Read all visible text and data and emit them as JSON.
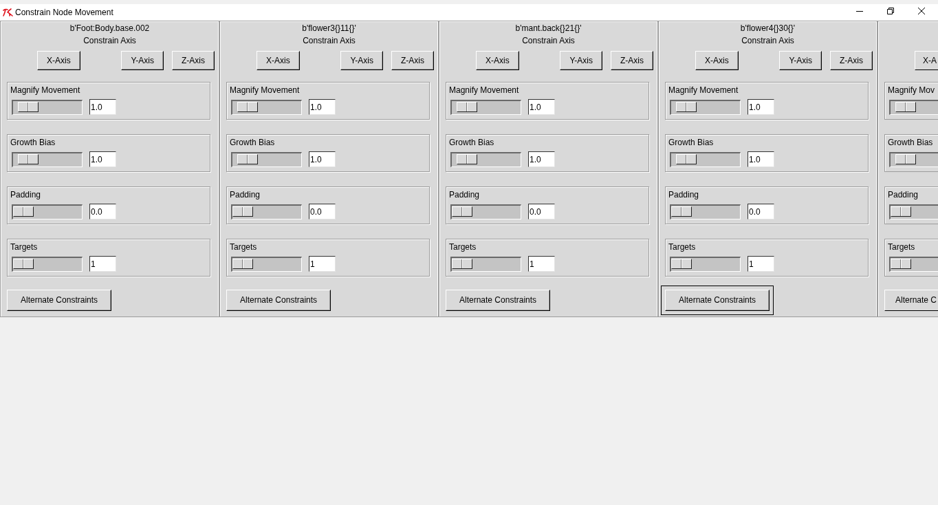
{
  "window": {
    "title": "Constrain Node Movement"
  },
  "panels": [
    {
      "node": "b'Foot:Body.base.002",
      "axis_label": "Constrain Axis",
      "axis_buttons": [
        "X-Axis",
        "Y-Axis",
        "Z-Axis"
      ],
      "settings": [
        {
          "label": "Magnify Movement",
          "level": 0.1,
          "value": "1.0"
        },
        {
          "label": "Growth Bias",
          "level": 0.1,
          "value": "1.0"
        },
        {
          "label": "Padding",
          "level": 0,
          "value": "0.0"
        },
        {
          "label": "Targets",
          "level": 0,
          "value": "1"
        }
      ],
      "alternate_button": {
        "label": "Alternate Constraints",
        "focused": false
      }
    },
    {
      "node": "b'flower3{}11{}'",
      "axis_label": "Constrain Axis",
      "axis_buttons": [
        "X-Axis",
        "Y-Axis",
        "Z-Axis"
      ],
      "settings": [
        {
          "label": "Magnify Movement",
          "level": 0.1,
          "value": "1.0"
        },
        {
          "label": "Growth Bias",
          "level": 0.1,
          "value": "1.0"
        },
        {
          "label": "Padding",
          "level": 0,
          "value": "0.0"
        },
        {
          "label": "Targets",
          "level": 0,
          "value": "1"
        }
      ],
      "alternate_button": {
        "label": "Alternate Constraints",
        "focused": false
      }
    },
    {
      "node": "b'mant.back{}21{}'",
      "axis_label": "Constrain Axis",
      "axis_buttons": [
        "X-Axis",
        "Y-Axis",
        "Z-Axis"
      ],
      "settings": [
        {
          "label": "Magnify Movement",
          "level": 0.1,
          "value": "1.0"
        },
        {
          "label": "Growth Bias",
          "level": 0.1,
          "value": "1.0"
        },
        {
          "label": "Padding",
          "level": 0,
          "value": "0.0"
        },
        {
          "label": "Targets",
          "level": 0,
          "value": "1"
        }
      ],
      "alternate_button": {
        "label": "Alternate Constraints",
        "focused": false
      }
    },
    {
      "node": "b'flower4{}30{}'",
      "axis_label": "Constrain Axis",
      "axis_buttons": [
        "X-Axis",
        "Y-Axis",
        "Z-Axis"
      ],
      "settings": [
        {
          "label": "Magnify Movement",
          "level": 0.1,
          "value": "1.0"
        },
        {
          "label": "Growth Bias",
          "level": 0.1,
          "value": "1.0"
        },
        {
          "label": "Padding",
          "level": 0,
          "value": "0.0"
        },
        {
          "label": "Targets",
          "level": 0,
          "value": "1"
        }
      ],
      "alternate_button": {
        "label": "Alternate Constraints",
        "focused": true
      }
    },
    {
      "axis_buttons": [
        "X-A"
      ],
      "settings": [
        {
          "label": "Magnify Mov",
          "level": 0.1
        },
        {
          "label": "Growth Bias",
          "level": 0.1
        },
        {
          "label": "Padding",
          "level": 0
        },
        {
          "label": "Targets",
          "level": 0
        }
      ],
      "alternate_button": {
        "label": "Alternate C",
        "focused": false
      }
    }
  ]
}
